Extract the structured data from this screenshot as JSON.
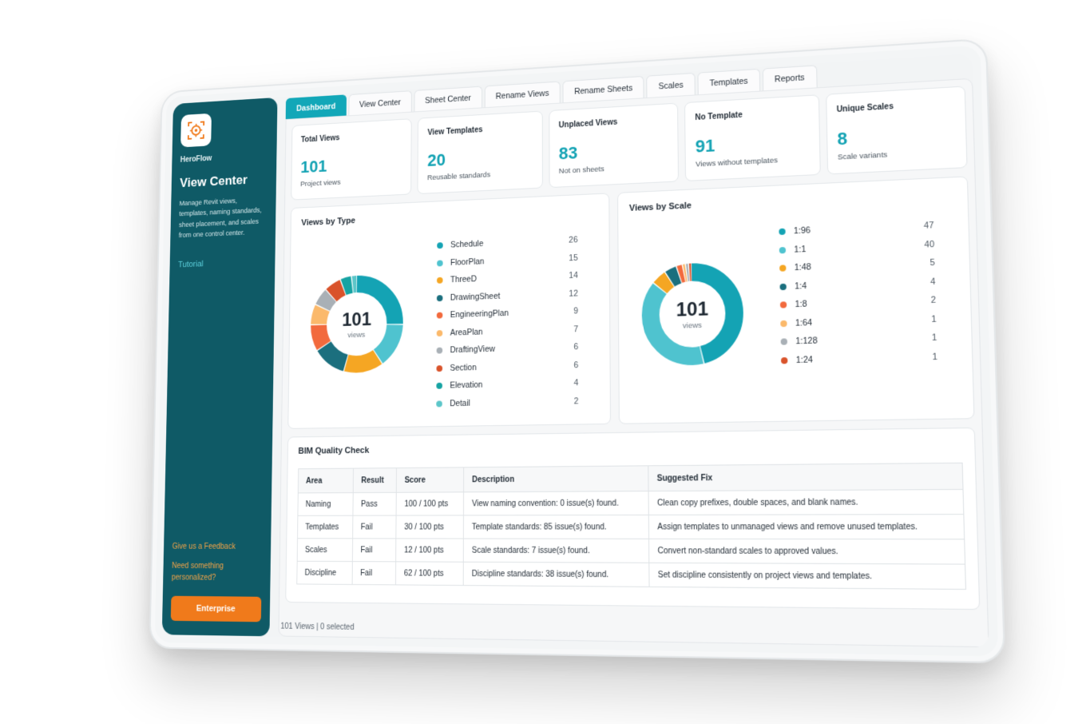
{
  "sidebar": {
    "brand": "HeroFlow",
    "title": "View Center",
    "description": "Manage Revit views, templates, naming standards, sheet placement, and scales from one control center.",
    "tutorial": "Tutorial",
    "feedback": "Give us a Feedback",
    "personalized": "Need something personalized?",
    "enterprise": "Enterprise",
    "logo_icon": "target-icon",
    "accent_color": "#0f5a66"
  },
  "tabs": [
    {
      "label": "Dashboard",
      "active": true
    },
    {
      "label": "View Center"
    },
    {
      "label": "Sheet Center"
    },
    {
      "label": "Rename Views"
    },
    {
      "label": "Rename Sheets"
    },
    {
      "label": "Scales"
    },
    {
      "label": "Templates"
    },
    {
      "label": "Reports"
    }
  ],
  "stats": [
    {
      "label": "Total Views",
      "value": "101",
      "sub": "Project views"
    },
    {
      "label": "View Templates",
      "value": "20",
      "sub": "Reusable standards"
    },
    {
      "label": "Unplaced Views",
      "value": "83",
      "sub": "Not on sheets"
    },
    {
      "label": "No Template",
      "value": "91",
      "sub": "Views without templates"
    },
    {
      "label": "Unique Scales",
      "value": "8",
      "sub": "Scale variants"
    }
  ],
  "chart_data": [
    {
      "type": "pie",
      "title": "Views by Type",
      "center_value": "101",
      "center_label": "views",
      "categories": [
        "Schedule",
        "FloorPlan",
        "ThreeD",
        "DrawingSheet",
        "EngineeringPlan",
        "AreaPlan",
        "DraftingView",
        "Section",
        "Elevation",
        "Detail"
      ],
      "values": [
        26,
        15,
        14,
        12,
        9,
        7,
        6,
        6,
        4,
        2
      ],
      "colors": [
        "#14a3b4",
        "#4fc3cf",
        "#f5a623",
        "#1b6f7e",
        "#f26a3d",
        "#fbb96b",
        "#a9b0b6",
        "#d9532b",
        "#16a3a3",
        "#5cc6c9"
      ]
    },
    {
      "type": "pie",
      "title": "Views by Scale",
      "center_value": "101",
      "center_label": "views",
      "categories": [
        "1:96",
        "1:1",
        "1:48",
        "1:4",
        "1:8",
        "1:64",
        "1:128",
        "1:24"
      ],
      "values": [
        47,
        40,
        5,
        4,
        2,
        1,
        1,
        1
      ],
      "colors": [
        "#14a3b4",
        "#4fc3cf",
        "#f5a623",
        "#1b6f7e",
        "#f26a3d",
        "#fbb96b",
        "#a9b0b6",
        "#d9532b"
      ]
    }
  ],
  "quality": {
    "title": "BIM Quality Check",
    "columns": [
      "Area",
      "Result",
      "Score",
      "Description",
      "Suggested Fix"
    ],
    "rows": [
      [
        "Naming",
        "Pass",
        "100 / 100 pts",
        "View naming convention: 0 issue(s) found.",
        "Clean copy prefixes, double spaces, and blank names."
      ],
      [
        "Templates",
        "Fail",
        "30 / 100 pts",
        "Template standards: 85 issue(s) found.",
        "Assign templates to unmanaged views and remove unused templates."
      ],
      [
        "Scales",
        "Fail",
        "12 / 100 pts",
        "Scale standards: 7 issue(s) found.",
        "Convert non-standard scales to approved values."
      ],
      [
        "Discipline",
        "Fail",
        "62 / 100 pts",
        "Discipline standards: 38 issue(s) found.",
        "Set discipline consistently on project views and templates."
      ]
    ]
  },
  "status_bar": "101 Views | 0 selected"
}
